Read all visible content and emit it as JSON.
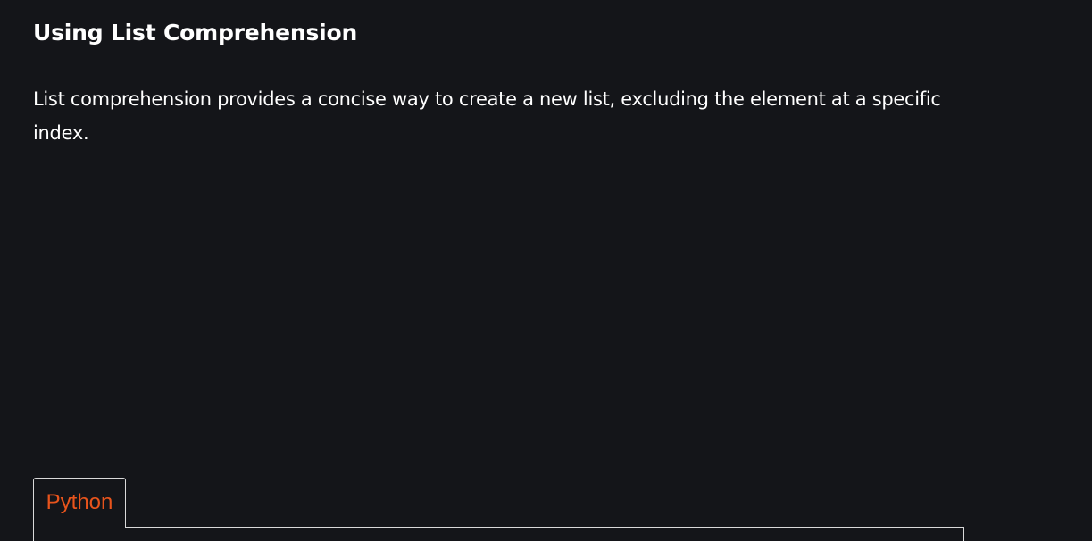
{
  "section": {
    "title": "Using List Comprehension",
    "description": "List comprehension provides a concise way to create a new list, excluding the element at a specific index."
  },
  "code_block": {
    "tabs": [
      {
        "label": "Python"
      }
    ]
  },
  "colors": {
    "background": "#141519",
    "text": "#ffffff",
    "tab_label": "#e8541c",
    "border": "#d9d9d9"
  }
}
